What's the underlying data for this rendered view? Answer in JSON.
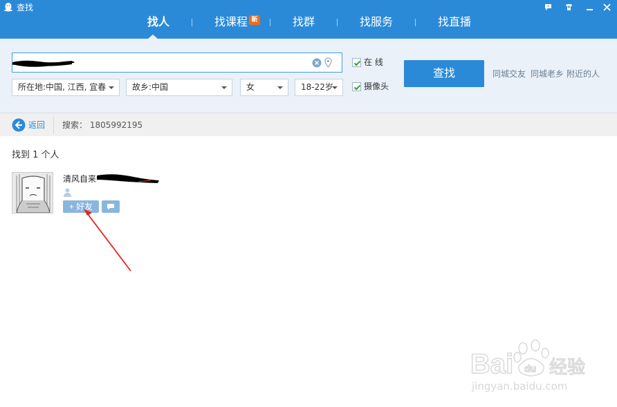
{
  "window": {
    "title": "查找",
    "controls": [
      "feedback-icon",
      "skin-icon",
      "minimize-icon",
      "close-icon"
    ]
  },
  "tabs": [
    {
      "label": "找人",
      "active": true
    },
    {
      "label": "找课程",
      "badge": "新"
    },
    {
      "label": "找群"
    },
    {
      "label": "找服务"
    },
    {
      "label": "找直播"
    }
  ],
  "search": {
    "value": "",
    "filters": {
      "location": "所在地:中国, 江西, 宜春",
      "hometown": "故乡:中国",
      "gender": "女",
      "age": "18-22岁"
    },
    "options": {
      "online": {
        "label": "在  线",
        "checked": true
      },
      "camera": {
        "label": "摄像头",
        "checked": true
      }
    },
    "button_label": "查找",
    "quick_links": [
      "同城交友",
      "同城老乡",
      "附近的人"
    ]
  },
  "breadcrumb": {
    "back_label": "返回",
    "query_text": "搜索： 1805992195"
  },
  "results": {
    "count_text": "找到 1 个人",
    "items": [
      {
        "name": "清风自来",
        "add_friend_label": "+ 好友"
      }
    ]
  },
  "watermark": {
    "url": "jingyan.baidu.com"
  },
  "colors": {
    "header": "#2b8ad8",
    "panel": "#eaf1f9",
    "button": "#2b8ad8",
    "badge": "#f46b13",
    "annotation": "#e8231f"
  }
}
